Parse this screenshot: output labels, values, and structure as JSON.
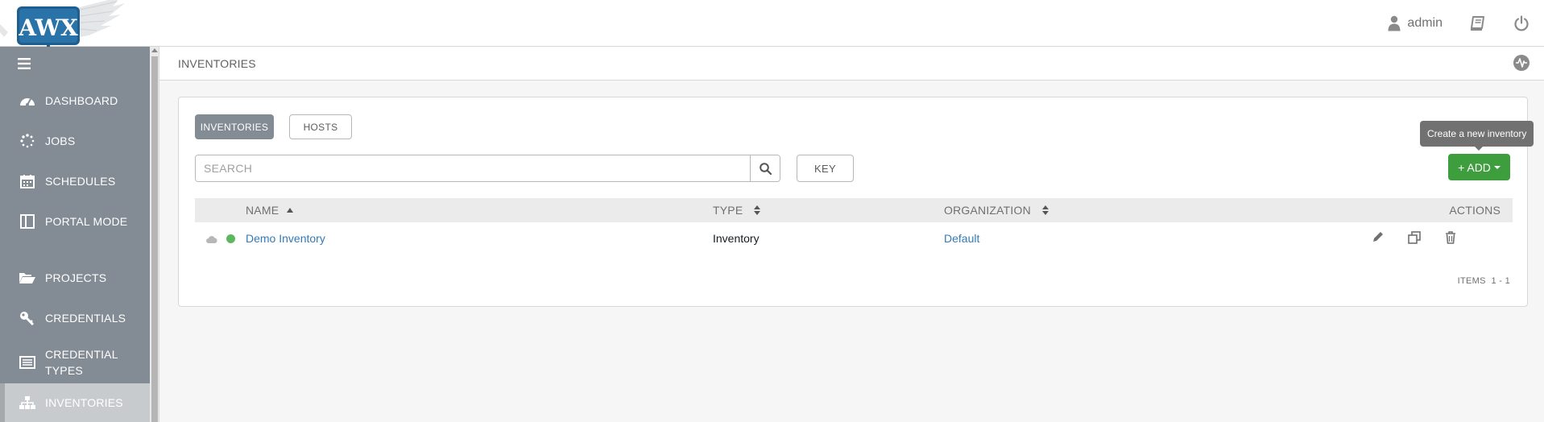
{
  "app": {
    "logo_text": "AWX"
  },
  "header": {
    "user_name": "admin",
    "icons": [
      "user-icon",
      "docs-book-icon",
      "logout-power-icon"
    ]
  },
  "sidebar": {
    "items": [
      {
        "label": "DASHBOARD",
        "icon": "dashboard-icon"
      },
      {
        "label": "JOBS",
        "icon": "jobs-spinner-icon"
      },
      {
        "label": "SCHEDULES",
        "icon": "calendar-icon"
      },
      {
        "label": "PORTAL MODE",
        "icon": "portal-icon"
      },
      {
        "label": "PROJECTS",
        "icon": "folder-icon"
      },
      {
        "label": "CREDENTIALS",
        "icon": "key-icon"
      },
      {
        "label": "CREDENTIAL TYPES",
        "icon": "list-icon"
      },
      {
        "label": "INVENTORIES",
        "icon": "sitemap-icon",
        "active": true
      }
    ]
  },
  "page": {
    "title": "INVENTORIES"
  },
  "panel": {
    "tabs": [
      {
        "label": "INVENTORIES",
        "active": true
      },
      {
        "label": "HOSTS",
        "active": false
      }
    ],
    "search": {
      "placeholder": "SEARCH",
      "value": ""
    },
    "key_label": "KEY",
    "add_label": "+ ADD",
    "add_tooltip": "Create a new inventory",
    "columns": {
      "name": "NAME",
      "type": "TYPE",
      "organization": "ORGANIZATION",
      "actions": "ACTIONS"
    },
    "rows": [
      {
        "name": "Demo Inventory",
        "type": "Inventory",
        "organization": "Default",
        "status": "success"
      }
    ],
    "items_label": "ITEMS",
    "items_range": "1 - 1"
  },
  "colors": {
    "sidebar_bg": "#838b94",
    "add_button": "#3e9e3e",
    "link": "#337ab7",
    "status_ok": "#5cb85c"
  }
}
